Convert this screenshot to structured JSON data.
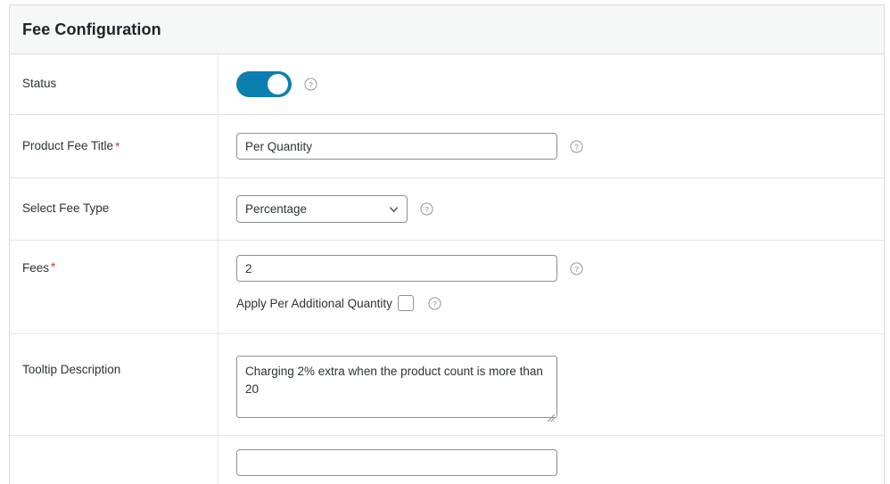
{
  "panel": {
    "title": "Fee Configuration"
  },
  "colors": {
    "toggle_on": "#0c7fb0",
    "required_asterisk": "#d63638",
    "header_bg": "#f6f7f7",
    "border": "#dcdcde",
    "input_border": "#8c8f94",
    "text": "#2c3338"
  },
  "rows": {
    "status": {
      "label": "Status",
      "toggle_state": "on",
      "help_icon": "question-circle-icon"
    },
    "product_fee_title": {
      "label": "Product Fee Title",
      "required": true,
      "required_marker": "*",
      "value": "Per Quantity",
      "placeholder": "",
      "help_icon": "question-circle-icon"
    },
    "select_fee_type": {
      "label": "Select Fee Type",
      "required": false,
      "selected": "Percentage",
      "options": [
        "Percentage"
      ],
      "chevron_icon": "chevron-down-icon",
      "help_icon": "question-circle-icon"
    },
    "fees": {
      "label": "Fees",
      "required": true,
      "required_marker": "*",
      "value": "2",
      "placeholder": "",
      "help_icon": "question-circle-icon",
      "checkbox": {
        "label": "Apply Per Additional Quantity",
        "checked": false,
        "help_icon": "question-circle-icon"
      }
    },
    "tooltip_description": {
      "label": "Tooltip Description",
      "required": false,
      "value": "Charging 2% extra when the product count is more than 20",
      "placeholder": "",
      "resize_handle_icon": "resize-grip-icon"
    },
    "partial_last": {
      "label": "",
      "value": ""
    }
  }
}
